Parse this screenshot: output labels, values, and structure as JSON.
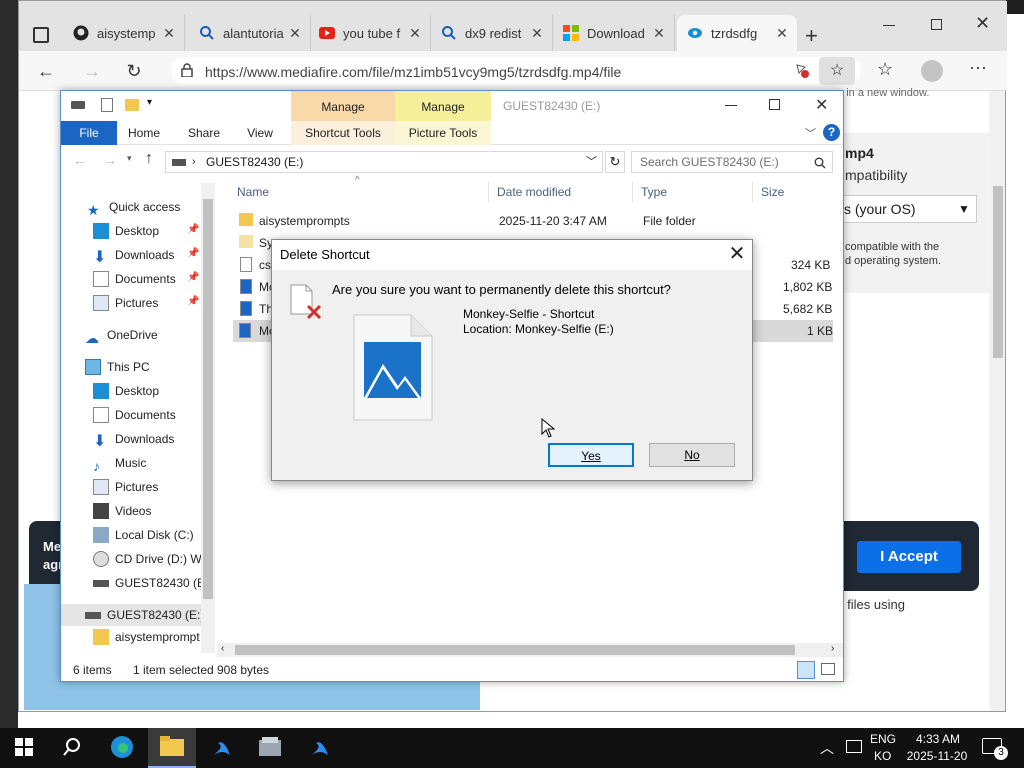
{
  "browser": {
    "tabs": [
      {
        "title": "aisystemp",
        "icon": "github-icon"
      },
      {
        "title": "alantutoria",
        "icon": "search-icon"
      },
      {
        "title": "you tube f",
        "icon": "youtube-icon"
      },
      {
        "title": "dx9 redist",
        "icon": "search-icon"
      },
      {
        "title": "Download",
        "icon": "microsoft-icon"
      },
      {
        "title": "tzrdsdfg",
        "icon": "mediafire-icon"
      }
    ],
    "url": "https://www.mediafire.com/file/mz1imb51vcy9mg5/tzrdsdfg.mp4/file"
  },
  "page": {
    "right_top": "rs in a new window.",
    "right_heading": "mp4",
    "right_compat": "mpatibility",
    "os_select": "s (your OS)",
    "compat_note_1": "compatible with the",
    "compat_note_2": "d operating system.",
    "cookie_text_1": "Me",
    "cookie_text_2": "agr",
    "accept_label": "I Accept",
    "risk_text": "-risk files using"
  },
  "explorer": {
    "title": "GUEST82430 (E:)",
    "manage_1": "Manage",
    "manage_2": "Manage",
    "ribbon_tabs": [
      "File",
      "Home",
      "Share",
      "View",
      "Shortcut Tools",
      "Picture Tools"
    ],
    "path": "GUEST82430 (E:)",
    "search_placeholder": "Search GUEST82430 (E:)",
    "columns": {
      "name": "Name",
      "date": "Date modified",
      "type": "Type",
      "size": "Size"
    },
    "rows": [
      {
        "name": "aisystemprompts",
        "date": "2025-11-20 3:47 AM",
        "type": "File folder",
        "size": ""
      },
      {
        "name": "Syst",
        "date": "",
        "type": "",
        "size": ""
      },
      {
        "name": "csr",
        "date": "",
        "type": "",
        "size": "324 KB"
      },
      {
        "name": "Mo",
        "date": "",
        "type": "",
        "size": "1,802 KB"
      },
      {
        "name": "Th",
        "date": "",
        "type": "",
        "size": "5,682 KB"
      },
      {
        "name": "Mo",
        "date": "",
        "type": "",
        "size": "1 KB"
      }
    ],
    "nav": {
      "quick_access": "Quick access",
      "qa_items": [
        "Desktop",
        "Downloads",
        "Documents",
        "Pictures"
      ],
      "onedrive": "OneDrive",
      "this_pc": "This PC",
      "pc_items": [
        "Desktop",
        "Documents",
        "Downloads",
        "Music",
        "Pictures",
        "Videos",
        "Local Disk (C:)",
        "CD Drive (D:) WI",
        "GUEST82430 (E:)"
      ],
      "drive": "GUEST82430 (E:)",
      "sub_folder": "aisystemprompt"
    },
    "status": {
      "items": "6 items",
      "selected": "1 item selected",
      "bytes": "908 bytes"
    }
  },
  "dialog": {
    "title": "Delete Shortcut",
    "question": "Are you sure you want to permanently delete this shortcut?",
    "file_name": "Monkey-Selfie - Shortcut",
    "location": "Location: Monkey-Selfie (E:)",
    "yes": "Yes",
    "no": "No"
  },
  "taskbar": {
    "lang_1": "ENG",
    "lang_2": "KO",
    "time": "4:33 AM",
    "date": "2025-11-20",
    "notification_count": "3"
  }
}
